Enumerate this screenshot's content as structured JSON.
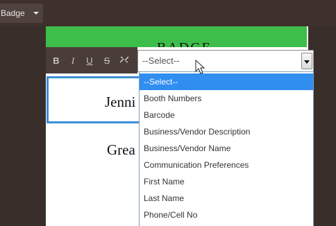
{
  "topbar": {
    "badge_dropdown_label": "Badge"
  },
  "header": {
    "partial_title": "BADGE"
  },
  "toolbar": {
    "bold": "B",
    "italic": "I",
    "underline": "U",
    "strike": "S",
    "icons": [
      "bold-icon",
      "italic-icon",
      "underline-icon",
      "strikethrough-icon",
      "unlink-icon"
    ]
  },
  "canvas": {
    "text_1": "Jenni",
    "text_2": "Grea"
  },
  "field_select": {
    "value": "--Select--",
    "options": [
      "--Select--",
      "Booth Numbers",
      "Barcode",
      "Business/Vendor Description",
      "Business/Vendor Name",
      "Communication Preferences",
      "First Name",
      "Last Name",
      "Phone/Cell No"
    ],
    "selected_index": 0
  },
  "colors": {
    "header_green": "#3dbd4a",
    "selection_blue": "#2f8ef0",
    "focus_border": "#3d8fd6",
    "app_background": "#3c302c"
  }
}
